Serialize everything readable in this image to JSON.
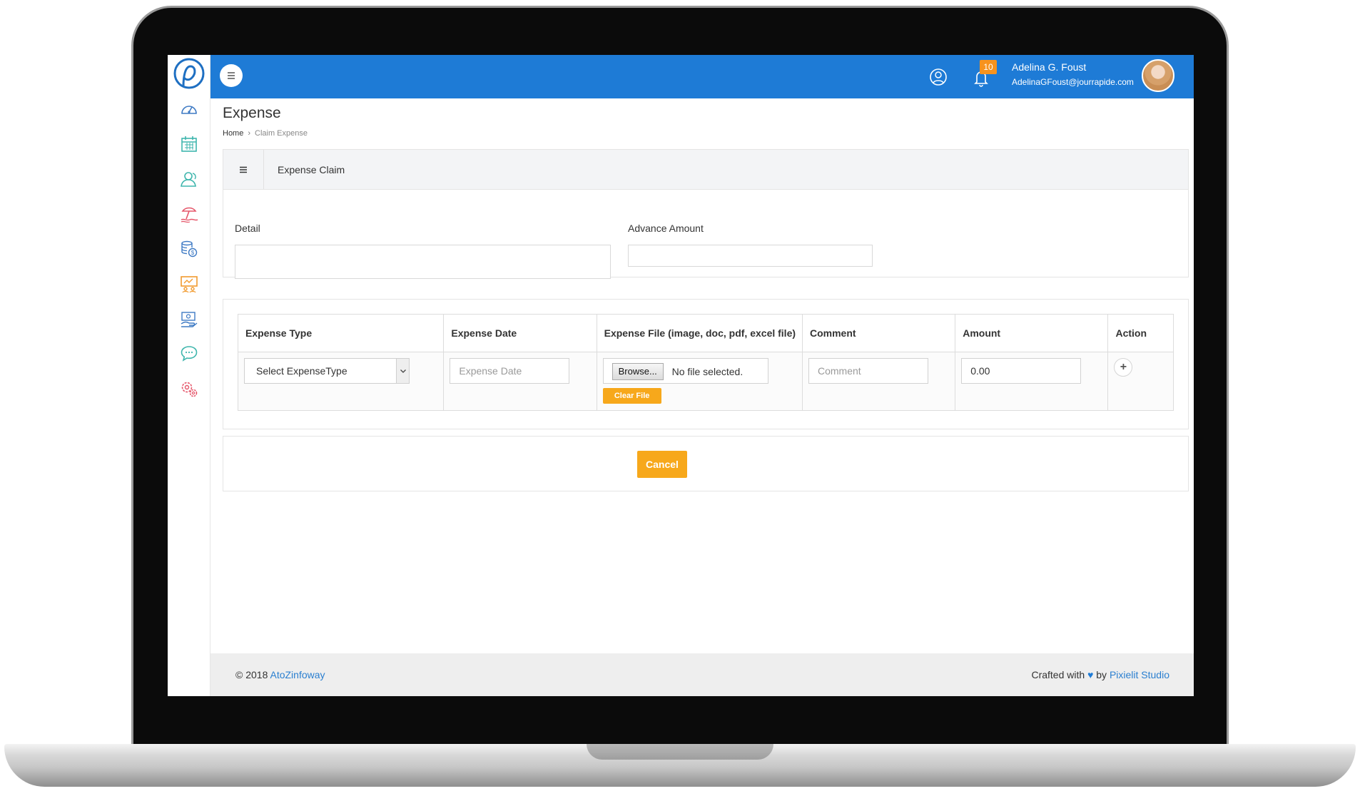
{
  "header": {
    "notification_count": "10",
    "user_name": "Adelina G. Foust",
    "user_email": "AdelinaGFoust@jourrapide.com",
    "color": "#1e7bd6"
  },
  "sidebar": {
    "items": [
      {
        "icon": "dashboard-icon",
        "color": "#3e7ac4"
      },
      {
        "icon": "calendar-icon",
        "color": "#3fb6ad"
      },
      {
        "icon": "users-icon",
        "color": "#3fb6ad"
      },
      {
        "icon": "beach-icon",
        "color": "#e5566a"
      },
      {
        "icon": "money-icon",
        "color": "#3e7ac4"
      },
      {
        "icon": "presentation-icon",
        "color": "#f29a2e"
      },
      {
        "icon": "payment-icon",
        "color": "#3e7ac4"
      },
      {
        "icon": "chat-icon",
        "color": "#3fb6ad"
      },
      {
        "icon": "settings-icon",
        "color": "#e5566a"
      }
    ]
  },
  "page": {
    "title": "Expense",
    "breadcrumb_home": "Home",
    "breadcrumb_current": "Claim Expense"
  },
  "claim": {
    "panel_title": "Expense Claim",
    "detail_label": "Detail",
    "detail_value": "",
    "advance_label": "Advance Amount",
    "advance_value": ""
  },
  "table": {
    "headers": [
      "Expense Type",
      "Expense Date",
      "Expense File (image, doc, pdf, excel file)",
      "Comment",
      "Amount",
      "Action"
    ],
    "row": {
      "expense_type": "Select ExpenseType",
      "date_placeholder": "Expense Date",
      "browse_label": "Browse...",
      "file_status": "No file selected.",
      "clear_label": "Clear File",
      "comment_placeholder": "Comment",
      "amount": "0.00",
      "add_symbol": "+"
    }
  },
  "actions": {
    "cancel_label": "Cancel"
  },
  "footer": {
    "copyright": "© 2018",
    "company": "AtoZinfoway",
    "crafted": "Crafted with",
    "by": "by",
    "studio": "Pixielit Studio"
  },
  "colors": {
    "accent": "#f7a81b",
    "badge": "#f7931e",
    "link": "#2a7fd0"
  }
}
